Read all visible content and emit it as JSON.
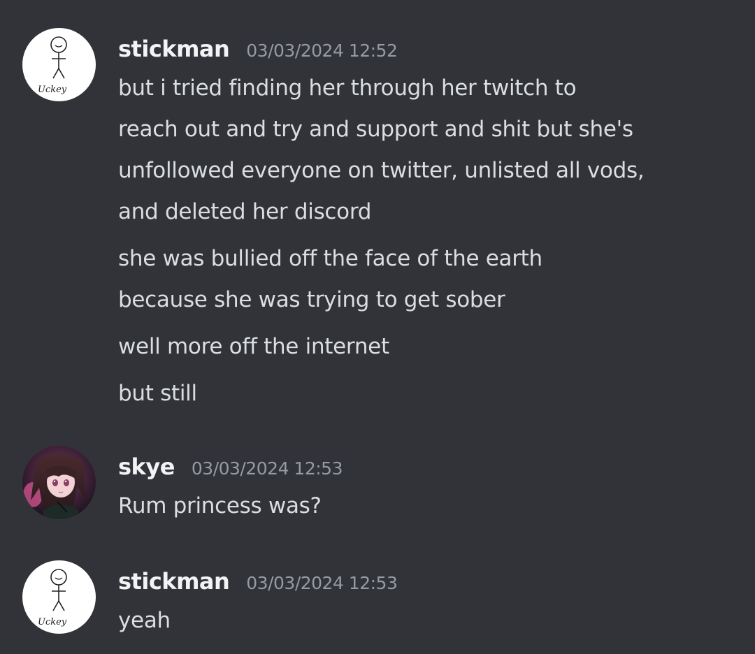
{
  "messages": [
    {
      "author": "stickman",
      "timestamp": "03/03/2024 12:52",
      "avatar": {
        "icon": "stick-figure-icon",
        "signature": "Uckey"
      },
      "lines": [
        "but i tried finding her through her twitch to",
        "reach out and try and support and shit but she's",
        "unfollowed everyone on twitter, unlisted all vods,",
        "and deleted her discord",
        "she was bullied off the face of the earth",
        "because she was trying to get sober",
        "well more off the internet",
        "but still"
      ]
    },
    {
      "author": "skye",
      "timestamp": "03/03/2024 12:53",
      "avatar": {
        "icon": "anime-girl-avatar"
      },
      "lines": [
        "Rum princess was?"
      ]
    },
    {
      "author": "stickman",
      "timestamp": "03/03/2024 12:53",
      "avatar": {
        "icon": "stick-figure-icon",
        "signature": "Uckey"
      },
      "lines": [
        "yeah"
      ]
    }
  ],
  "colors": {
    "background": "#313338",
    "username": "#f2f3f5",
    "timestamp": "#949ba4",
    "text": "#dbdee1"
  }
}
